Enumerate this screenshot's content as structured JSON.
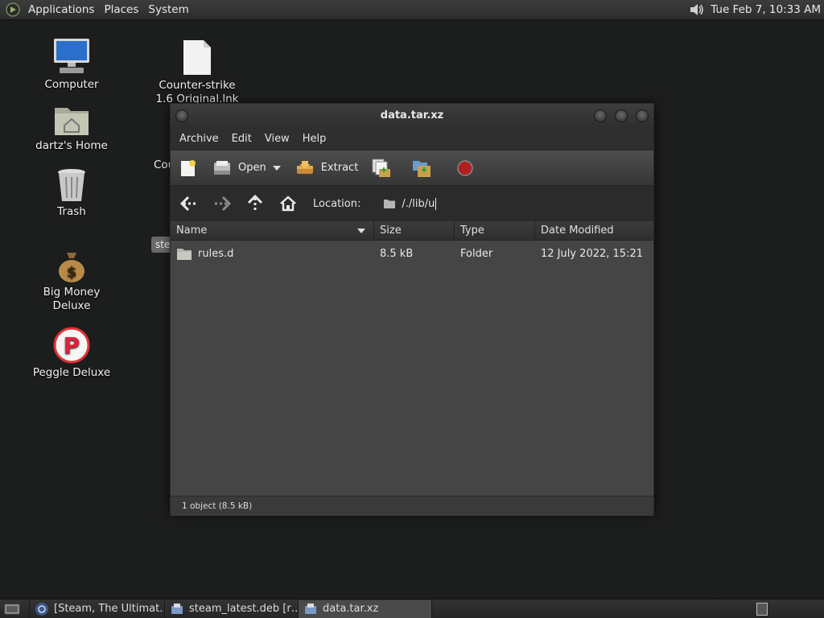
{
  "top_panel": {
    "menus": [
      "Applications",
      "Places",
      "System"
    ],
    "clock": "Tue Feb  7, 10:33 AM"
  },
  "desktop": {
    "icons": [
      {
        "label": "Computer",
        "icon": "computer-icon"
      },
      {
        "label": "Counter-strike 1.6 Original.lnk",
        "icon": "file-icon"
      },
      {
        "label": "dartz's Home",
        "icon": "home-folder-icon"
      },
      {
        "label": "Trash",
        "icon": "trash-icon"
      },
      {
        "label": "Big Money Deluxe",
        "icon": "money-bag-icon"
      },
      {
        "label": "Peggle Deluxe",
        "icon": "peggle-icon"
      }
    ],
    "cropped_label": "Cou",
    "cropped_tag": "ste"
  },
  "window": {
    "title": "data.tar.xz",
    "menu": [
      "Archive",
      "Edit",
      "View",
      "Help"
    ],
    "toolbar": {
      "open": "Open",
      "extract": "Extract"
    },
    "location": {
      "label": "Location:",
      "path": "/./lib/u"
    },
    "columns": [
      "Name",
      "Size",
      "Type",
      "Date Modified"
    ],
    "files": [
      {
        "name": "rules.d",
        "size": "8.5 kB",
        "type": "Folder",
        "modified": "12 July 2022, 15:21"
      }
    ],
    "status": "1 object (8.5 kB)"
  },
  "taskbar": {
    "tasks": [
      {
        "label": "[Steam, The Ultimat…",
        "active": false
      },
      {
        "label": "steam_latest.deb [r…",
        "active": false
      },
      {
        "label": "data.tar.xz",
        "active": true
      }
    ]
  }
}
